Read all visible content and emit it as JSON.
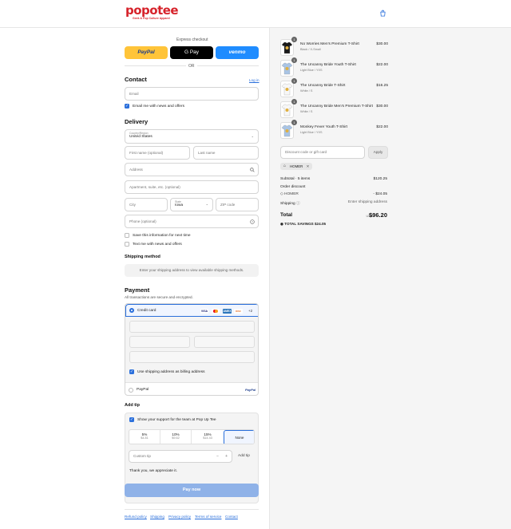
{
  "header": {
    "logo": "popotee",
    "tagline": "Geek & Pop Culture Apparel",
    "cart_icon": "shopping-bag-icon"
  },
  "express": {
    "title": "Express checkout",
    "paypal": "PayPal",
    "gpay": "G Pay",
    "venmo": "venmo",
    "or": "OR"
  },
  "contact": {
    "title": "Contact",
    "login": "Log in",
    "email_placeholder": "Email",
    "news": "Email me with news and offers"
  },
  "delivery": {
    "title": "Delivery",
    "country_label": "Country/Region",
    "country": "United States",
    "first": "First name (optional)",
    "last": "Last name",
    "address": "Address",
    "apt": "Apartment, suite, etc. (optional)",
    "city": "City",
    "state_label": "State",
    "state": "Iowa",
    "zip": "ZIP code",
    "phone": "Phone (optional)",
    "save": "Save this information for next time",
    "text": "Text me with news and offers"
  },
  "shipping": {
    "title": "Shipping method",
    "note": "Enter your shipping address to view available shipping methods."
  },
  "payment": {
    "title": "Payment",
    "sub": "All transactions are secure and encrypted.",
    "card": "Credit card",
    "brands": [
      "VISA",
      "MC",
      "AMEX",
      "DISC"
    ],
    "more": "+2",
    "billing": "Use shipping address as billing address",
    "paypal": "PayPal",
    "paypal_logo": "PayPal"
  },
  "tip": {
    "title": "Add tip",
    "support": "Show your support for the team at Pop Up Tee",
    "options": [
      {
        "pct": "5%",
        "amt": "$4.81"
      },
      {
        "pct": "10%",
        "amt": "$9.62"
      },
      {
        "pct": "15%",
        "amt": "$14.43"
      },
      {
        "pct": "None",
        "amt": ""
      }
    ],
    "custom": "Custom tip",
    "add": "Add tip",
    "thanks": "Thank you, we appreciate it."
  },
  "pay": {
    "label": "Pay now"
  },
  "footer": {
    "links": [
      "Refund policy",
      "Shipping",
      "Privacy policy",
      "Terms of service",
      "Contact"
    ]
  },
  "cart": {
    "items": [
      {
        "qty": "1",
        "name": "No Worries Men's Premium T-Shirt",
        "variant": "Black / X-Small",
        "price": "$30.00",
        "shirt": "#1a1a1a"
      },
      {
        "qty": "1",
        "name": "The Uncanny Bride Youth T-Shirt",
        "variant": "Light Blue / YXS",
        "price": "$22.00",
        "shirt": "#a9c4e4"
      },
      {
        "qty": "1",
        "name": "The Uncanny Bride T-Shirt",
        "variant": "White / S",
        "price": "$16.25",
        "shirt": "#f7f7f7"
      },
      {
        "qty": "1",
        "name": "The Uncanny Bride Men's Premium T-Shirt",
        "variant": "White / S",
        "price": "$30.00",
        "shirt": "#f7f7f7"
      },
      {
        "qty": "1",
        "name": "Monkey Fever Youth T-Shirt",
        "variant": "Light Blue / YXS",
        "price": "$22.00",
        "shirt": "#a9c4e4"
      }
    ],
    "discount_placeholder": "Discount code or gift card",
    "apply": "Apply",
    "code_chip": "HOMER",
    "subtotal_label": "Subtotal · 5 items",
    "subtotal": "$120.25",
    "order_discount": "Order discount",
    "discount_code": "HOMER",
    "discount_value": "- $24.05",
    "shipping_label": "Shipping",
    "shipping_value": "Enter shipping address",
    "total_label": "Total",
    "currency": "USD",
    "total": "$96.20",
    "savings_label": "TOTAL SAVINGS",
    "savings": "$24.05"
  }
}
